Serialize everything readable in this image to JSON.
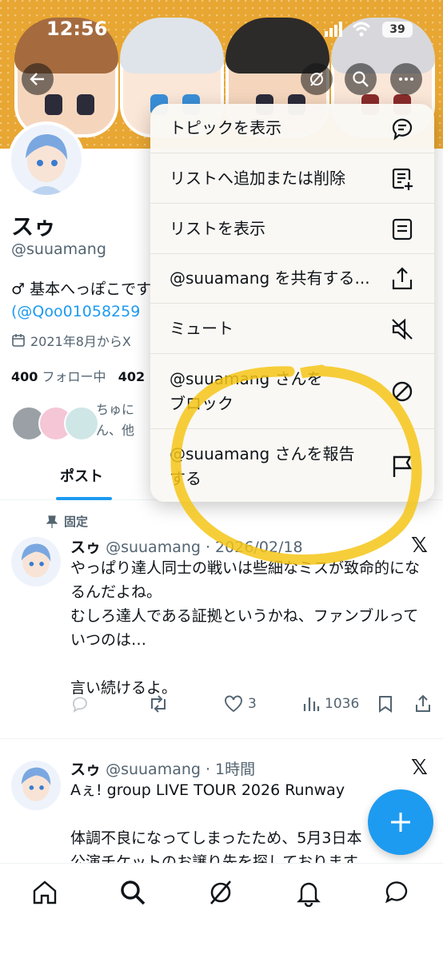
{
  "status_bar": {
    "time": "12:56",
    "battery": "39"
  },
  "profile": {
    "name": "スゥ",
    "handle": "@suuamang",
    "bio_text": "♂ 基本へっぽこです",
    "bio_link": "(@Qoo01058259",
    "joined": "2021年8月からX",
    "following_count": "400",
    "following_label": "フォロー中",
    "followers_count": "402",
    "followed_by_line1": "ちゅに",
    "followed_by_line2": "ん、他"
  },
  "tabs": {
    "posts": "ポスト"
  },
  "menu": {
    "items": [
      {
        "label": "トピックを表示",
        "icon": "topic-icon"
      },
      {
        "label": "リストへ追加または削除",
        "icon": "list-add-icon"
      },
      {
        "label": "リストを表示",
        "icon": "list-icon"
      },
      {
        "label": "@suuamang を共有する...",
        "icon": "share-icon"
      },
      {
        "label": "ミュート",
        "icon": "mute-icon"
      },
      {
        "label": "@suuamang さんを\nブロック",
        "icon": "block-icon"
      },
      {
        "label": "@suuamang さんを報告\nする",
        "icon": "flag-icon"
      }
    ]
  },
  "pinned_label": "固定",
  "tweets": [
    {
      "name": "スゥ",
      "meta": "@suuamang · 2026/02/18",
      "body": "やっぱり達人同士の戦いは些細なミスが致命的になるんだよね。\nむしろ達人である証拠というかね、ファンブルっていつのは…\n\n言い続けるよ。",
      "likes": "3",
      "views": "1036"
    },
    {
      "name": "スゥ",
      "meta": "@suuamang · 1時間",
      "body": "Aぇ! group LIVE TOUR 2026 Runway\n\n体調不良になってしまったため、5月3日本\n公演チケットのお譲り先を探しております。"
    }
  ],
  "colors": {
    "accent": "#1d9bf0",
    "banner": "#e8a632",
    "highlight": "#f5c518"
  }
}
